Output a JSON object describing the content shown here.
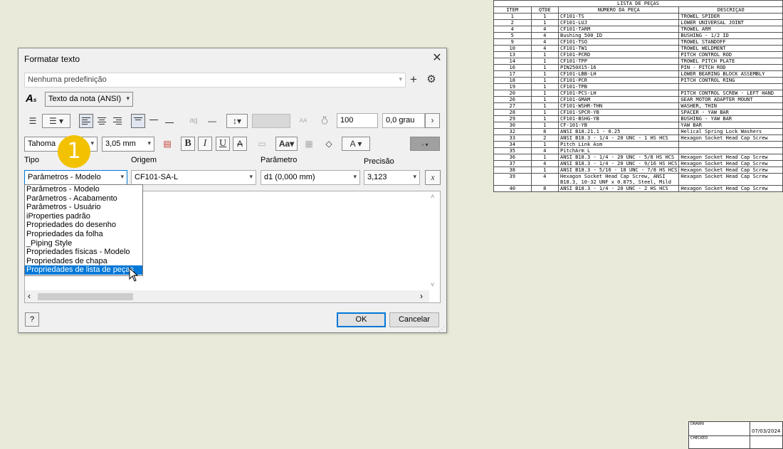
{
  "parts_list": {
    "title": "LISTA DE PEÇAS",
    "headers": [
      "ITEM",
      "QTDE",
      "NÚMERO DA PEÇA",
      "DESCRIÇÃO"
    ],
    "rows": [
      [
        "1",
        "1",
        "CF101-TS",
        "TROWEL SPIDER"
      ],
      [
        "2",
        "1",
        "CF101-LUJ",
        "LOWER UNIVERSAL JOINT"
      ],
      [
        "4",
        "4",
        "CF101-TARM",
        "TROWEL ARM"
      ],
      [
        "5",
        "4",
        "Bushing_500_ID",
        "BUSHING - 1/2 ID"
      ],
      [
        "9",
        "4",
        "CF101-TSO",
        "TROWEL STANDOFF"
      ],
      [
        "10",
        "4",
        "CF101-TW1",
        "TROWEL WELDMENT"
      ],
      [
        "13",
        "1",
        "CF101-PCRD",
        "PITCH CONTROL ROD"
      ],
      [
        "14",
        "1",
        "CF101-TPP",
        "TROWEL PITCH PLATE"
      ],
      [
        "16",
        "1",
        "PIN250X15-16",
        "PIN - PITCH ROD"
      ],
      [
        "17",
        "1",
        "CF101-LBB-LH",
        "LOWER BEARING BLOCK ASSEMBLY"
      ],
      [
        "18",
        "1",
        "CF101-PCR",
        "PITCH CONTROL RING"
      ],
      [
        "19",
        "1",
        "CF101-TPB",
        ""
      ],
      [
        "20",
        "1",
        "CF101-PCS-LH",
        "PITCH CONTROL SCREW - LEFT HAND"
      ],
      [
        "26",
        "1",
        "CF101-GMAM",
        "GEAR MOTOR ADAPTER MOUNT"
      ],
      [
        "27",
        "1",
        "CF101-WSHR-THN",
        "WASHER, THIN"
      ],
      [
        "28",
        "1",
        "CF101-SPCR-YB",
        "SPACER - YAW BAR"
      ],
      [
        "29",
        "1",
        "CF101-BSHG-YB",
        "BUSHING - YAW BAR"
      ],
      [
        "30",
        "1",
        "CF-101-YB",
        "YAW BAR"
      ],
      [
        "32",
        "8",
        "ANSI B18.21.1 - 0.25",
        "Helical Spring Lock Washers"
      ],
      [
        "33",
        "2",
        "ANSI B18.3 - 1/4 - 20 UNC - 1 HS HCS",
        "Hexagon Socket Head Cap Screw"
      ],
      [
        "34",
        "1",
        "Pitch Link Asm",
        ""
      ],
      [
        "35",
        "4",
        "PitchArm_L",
        ""
      ],
      [
        "36",
        "1",
        "ANSI B18.3 - 1/4 - 20 UNC - 5/8 HS HCS",
        "Hexagon Socket Head Cap Screw"
      ],
      [
        "37",
        "4",
        "ANSI B18.3 - 1/4 - 20 UNC - 9/16 HS HCS",
        "Hexagon Socket Head Cap Screw"
      ],
      [
        "38",
        "1",
        "ANSI B18.3 - 5/16 - 18 UNC - 7/8 HS HCS",
        "Hexagon Socket Head Cap Screw"
      ],
      [
        "39",
        "4",
        "Hexagon Socket Head Cap Screw, ANSI B18.3, 10-32 UNF x 0.875, Steel, Mild",
        "Hexagon Socket Head Cap Screw"
      ],
      [
        "40",
        "8",
        "ANSI B18.3 - 1/4 - 20 UNC - 2 HS HCS",
        "Hexagon Socket Head Cap Screw"
      ]
    ]
  },
  "title_block": {
    "drawn_label": "DRAWN",
    "drawn_date": "07/03/2024",
    "checked_label": "CHECKED"
  },
  "dialog": {
    "title": "Formatar texto",
    "preset": "Nenhuma predefinição",
    "style": "Texto da nota (ANSI)",
    "spacing_value": "100",
    "rotation_value": "0,0 grau",
    "font": "Tahoma",
    "font_size": "3,05 mm",
    "bold_label": "B",
    "italic_label": "I",
    "underline_label": "U",
    "strike_label": "A",
    "color_label": "A",
    "labels": {
      "tipo": "Tipo",
      "origem": "Origem",
      "parametro": "Parâmetro",
      "precisao": "Precisão"
    },
    "tipo_value": "Parâmetros - Modelo",
    "origem_value": "CF101-SA-L",
    "parametro_value": "d1 (0,000 mm)",
    "precisao_value": "3,123",
    "tipo_options": [
      "Parâmetros - Modelo",
      "Parâmetros - Acabamento",
      "Parâmetros - Usuário",
      "iProperties padrão",
      "Propriedades do desenho",
      "Propriedades da folha",
      "_Piping Style",
      "Propriedades físicas - Modelo",
      "Propriedades de chapa",
      "Propriedades de lista de peças"
    ],
    "tipo_selected_index": 9,
    "ok_label": "OK",
    "cancel_label": "Cancelar",
    "help_label": "?"
  },
  "callout": {
    "number": "1",
    "color": "#f2c200"
  },
  "colors": {
    "accent": "#0078d7",
    "sheet": "#e9ead9"
  }
}
